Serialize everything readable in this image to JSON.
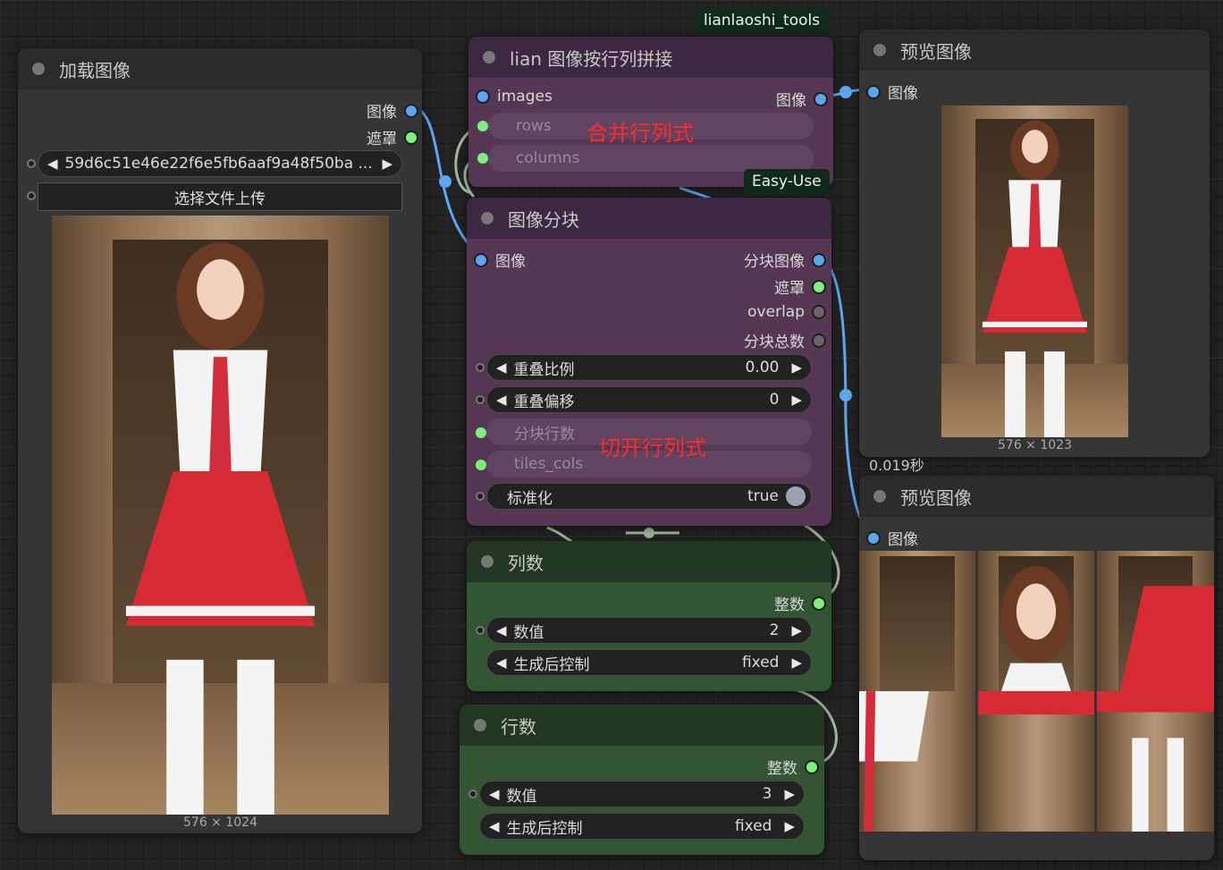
{
  "badges": {
    "tools": "lianlaoshi_tools",
    "easy_use": "Easy-Use"
  },
  "load_image": {
    "title": "加载图像",
    "outputs": [
      "图像",
      "遮罩"
    ],
    "filename": "59d6c51e46e22f6e5fb6aaf9a48f50ba ...",
    "upload_label": "选择文件上传",
    "size_caption": "576 × 1024"
  },
  "concat_node": {
    "title": "lian 图像按行列拼接",
    "input_images": "images",
    "output_image": "图像",
    "rows_label": "rows",
    "columns_label": "columns",
    "note": "合并行列式"
  },
  "tile_node": {
    "title": "图像分块",
    "input_image": "图像",
    "outputs": [
      "分块图像",
      "遮罩",
      "overlap",
      "分块总数"
    ],
    "overlap_rate": {
      "label": "重叠比例",
      "value": "0.00"
    },
    "overlap_offset": {
      "label": "重叠偏移",
      "value": "0"
    },
    "tiles_rows_label": "分块行数",
    "tiles_cols_label": "tiles_cols",
    "normalize": {
      "label": "标准化",
      "value": "true"
    },
    "note": "切开行列式"
  },
  "cols_node": {
    "title": "列数",
    "output": "整数",
    "value": {
      "label": "数值",
      "value": "2"
    },
    "control": {
      "label": "生成后控制",
      "value": "fixed"
    }
  },
  "rows_node": {
    "title": "行数",
    "output": "整数",
    "value": {
      "label": "数值",
      "value": "3"
    },
    "control": {
      "label": "生成后控制",
      "value": "fixed"
    }
  },
  "preview1": {
    "title": "预览图像",
    "input": "图像",
    "size_caption": "576 × 1023",
    "time": "0.019秒"
  },
  "preview2": {
    "title": "预览图像",
    "input": "图像"
  },
  "colors": {
    "wire_blue": "#5aa6ef",
    "wire_green": "#9fb59f",
    "port_green": "#7ef07e",
    "purple_node": "#553754",
    "green_node": "#335533",
    "note_red": "#ff2a2a"
  }
}
